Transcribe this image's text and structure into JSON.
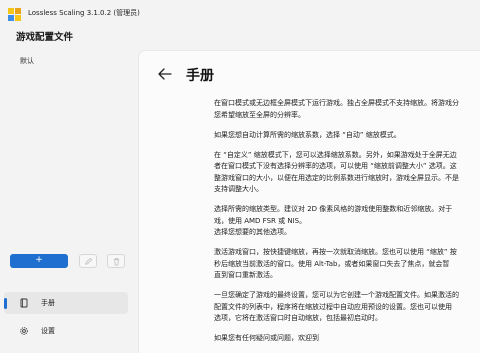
{
  "window": {
    "title": "Lossless Scaling 3.1.0.2 (管理员)"
  },
  "sidebar": {
    "header": "游戏配置文件",
    "profiles": [
      "默认"
    ],
    "add_label": "+",
    "nav": [
      {
        "label": "手册",
        "icon": "book-icon",
        "selected": true
      },
      {
        "label": "设置",
        "icon": "gear-icon",
        "selected": false
      }
    ]
  },
  "main": {
    "title": "手册",
    "paragraphs": [
      [
        "在窗口模式或无边框全屏模式下运行游戏。独占全屏模式不支持缩放。将游戏分",
        "您希望缩放至全屏的分辨率。"
      ],
      [
        "如果您想自动计算所需的缩放系数，选择 “自动” 缩放模式。"
      ],
      [
        "在 “自定义” 缩放模式下，您可以选择缩放系数。另外，如果游戏处于全屏无边",
        "者在窗口模式下没有选择分辨率的选项，可以使用 “缩放前调整大小” 选项。这",
        "整游戏窗口的大小，以便在用选定的比例系数进行缩放时，游戏全屏显示。不是",
        "支持调整大小。"
      ],
      [
        "选择所需的缩放类型。建议对 2D 像素风格的游戏使用整数和近邻缩放。对于",
        "戏，使用 AMD FSR 或 NIS。",
        "选择您想要的其他选项。"
      ],
      [
        "激活游戏窗口，按快捷键缩放，再按一次就取消缩放。您也可以使用 “缩放” 按",
        "秒后缩放当前激活的窗口。使用 Alt-Tab，或者如果窗口失去了焦点，就会暂",
        "直到窗口重新激活。"
      ],
      [
        "一旦您确定了游戏的最终设置，您可以为它创建一个游戏配置文件。如果激活的",
        "配置文件的列表中，程序将在缩放过程中自动应用预设的设置。您也可以使用",
        "选项，它将在激活窗口时自动缩放，包括最初启动时。"
      ],
      [
        "如果您有任何疑问或问题，欢迎到"
      ]
    ]
  },
  "colors": {
    "accent": "#1f6fd1",
    "background": "#f3f3f3",
    "content_bg": "#fbfbfb"
  }
}
